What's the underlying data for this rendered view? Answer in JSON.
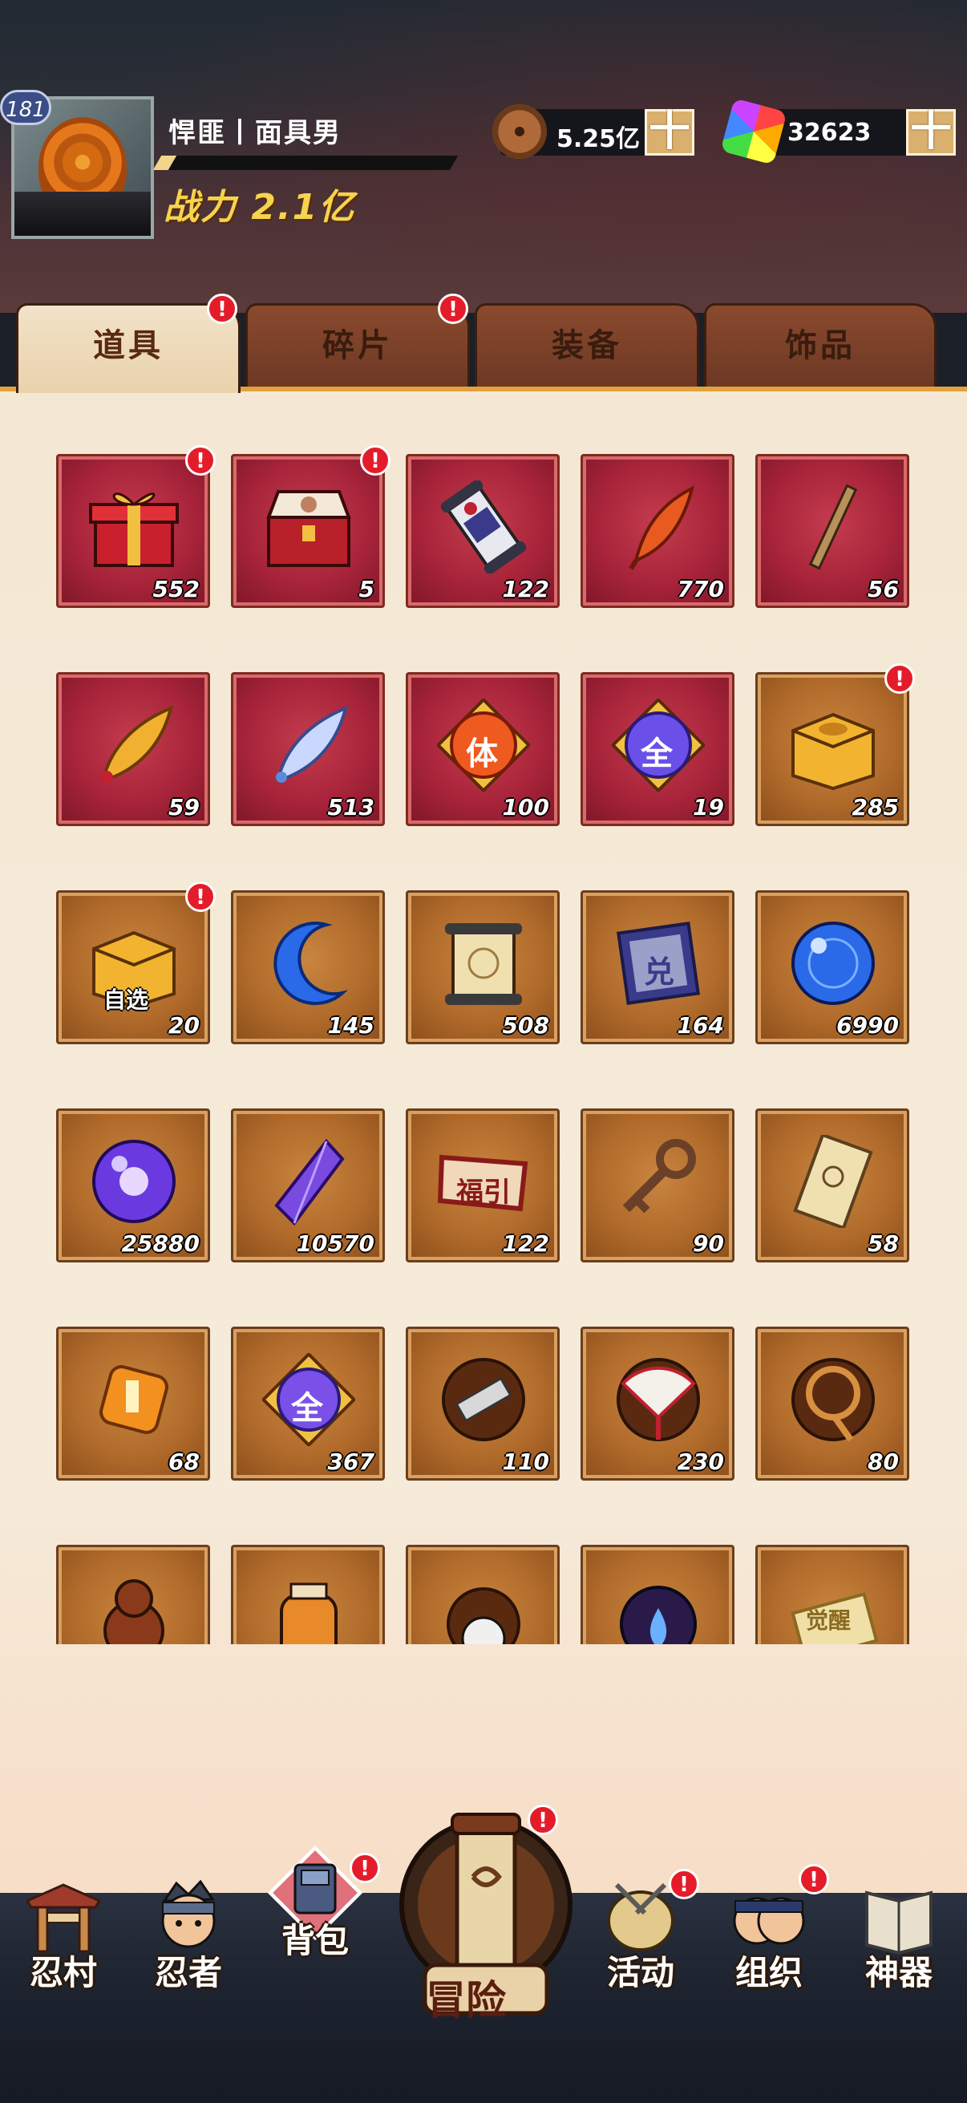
{
  "player": {
    "level": "181",
    "name": "悍匪丨面具男",
    "power": "战力 2.1亿",
    "exp_fraction": 0.05
  },
  "currency": {
    "coins": "5.25亿",
    "gems": "32623",
    "plus": "十"
  },
  "tabs": [
    {
      "label": "道具",
      "active": true,
      "alert": true
    },
    {
      "label": "碎片",
      "active": false,
      "alert": true
    },
    {
      "label": "装备",
      "active": false,
      "alert": false
    },
    {
      "label": "饰品",
      "active": false,
      "alert": false
    }
  ],
  "items": [
    {
      "icon": "gift-box-icon",
      "count": "552",
      "bg": "red",
      "alert": true
    },
    {
      "icon": "treasure-chest-icon",
      "count": "5",
      "bg": "red",
      "alert": true
    },
    {
      "icon": "scroll-icon",
      "count": "122",
      "bg": "red",
      "alert": false
    },
    {
      "icon": "red-feather-icon",
      "count": "770",
      "bg": "red",
      "alert": false
    },
    {
      "icon": "stick-icon",
      "count": "56",
      "bg": "red",
      "alert": false
    },
    {
      "icon": "gold-feather-icon",
      "count": "59",
      "bg": "red",
      "alert": false
    },
    {
      "icon": "blue-feather-icon",
      "count": "513",
      "bg": "red",
      "alert": false
    },
    {
      "icon": "body-orb-icon",
      "count": "100",
      "bg": "red",
      "alert": false,
      "glyph": "体"
    },
    {
      "icon": "all-orb-icon",
      "count": "19",
      "bg": "red",
      "alert": false,
      "glyph": "全"
    },
    {
      "icon": "gold-box-icon",
      "count": "285",
      "bg": "brown",
      "alert": true
    },
    {
      "icon": "select-box-icon",
      "count": "20",
      "bg": "brown",
      "alert": true,
      "glyph": "自选"
    },
    {
      "icon": "moon-crystal-icon",
      "count": "145",
      "bg": "brown",
      "alert": false
    },
    {
      "icon": "map-scroll-icon",
      "count": "508",
      "bg": "brown",
      "alert": false
    },
    {
      "icon": "exchange-ticket-icon",
      "count": "164",
      "bg": "brown",
      "alert": false,
      "glyph": "兑"
    },
    {
      "icon": "blue-orb-icon",
      "count": "6990",
      "bg": "brown",
      "alert": false
    },
    {
      "icon": "purple-orb-icon",
      "count": "25880",
      "bg": "brown",
      "alert": false
    },
    {
      "icon": "purple-crystal-icon",
      "count": "10570",
      "bg": "brown",
      "alert": false
    },
    {
      "icon": "fortune-banner-icon",
      "count": "122",
      "bg": "brown",
      "alert": false,
      "glyph": "福引"
    },
    {
      "icon": "key-icon",
      "count": "90",
      "bg": "brown",
      "alert": false
    },
    {
      "icon": "paper-charm-icon",
      "count": "58",
      "bg": "brown",
      "alert": false
    },
    {
      "icon": "amber-gem-icon",
      "count": "68",
      "bg": "brown",
      "alert": false
    },
    {
      "icon": "all-medal-icon",
      "count": "367",
      "bg": "brown",
      "alert": false,
      "glyph": "全"
    },
    {
      "icon": "shuriken-scroll-icon",
      "count": "110",
      "bg": "brown",
      "alert": false
    },
    {
      "icon": "fan-icon",
      "count": "230",
      "bg": "brown",
      "alert": false
    },
    {
      "icon": "rope-icon",
      "count": "80",
      "bg": "brown",
      "alert": false
    },
    {
      "icon": "gourd-icon",
      "count": "",
      "bg": "brown",
      "alert": false
    },
    {
      "icon": "jar-icon",
      "count": "",
      "bg": "brown",
      "alert": false
    },
    {
      "icon": "panda-icon",
      "count": "",
      "bg": "brown",
      "alert": false
    },
    {
      "icon": "spirit-orb-icon",
      "count": "",
      "bg": "brown",
      "alert": false
    },
    {
      "icon": "awaken-ticket-icon",
      "count": "",
      "bg": "brown",
      "alert": false,
      "glyph": "觉醒"
    }
  ],
  "nav": [
    {
      "label": "忍村",
      "icon": "village-gate-icon",
      "alert": false
    },
    {
      "label": "忍者",
      "icon": "ninja-face-icon",
      "alert": false
    },
    {
      "label": "背包",
      "icon": "backpack-icon",
      "alert": true
    },
    {
      "label": "冒险",
      "icon": "adventure-scroll-icon",
      "alert": true
    },
    {
      "label": "活动",
      "icon": "drum-icon",
      "alert": true
    },
    {
      "label": "组织",
      "icon": "organization-icon",
      "alert": true
    },
    {
      "label": "神器",
      "icon": "artifact-book-icon",
      "alert": false
    }
  ],
  "alert_mark": "!"
}
